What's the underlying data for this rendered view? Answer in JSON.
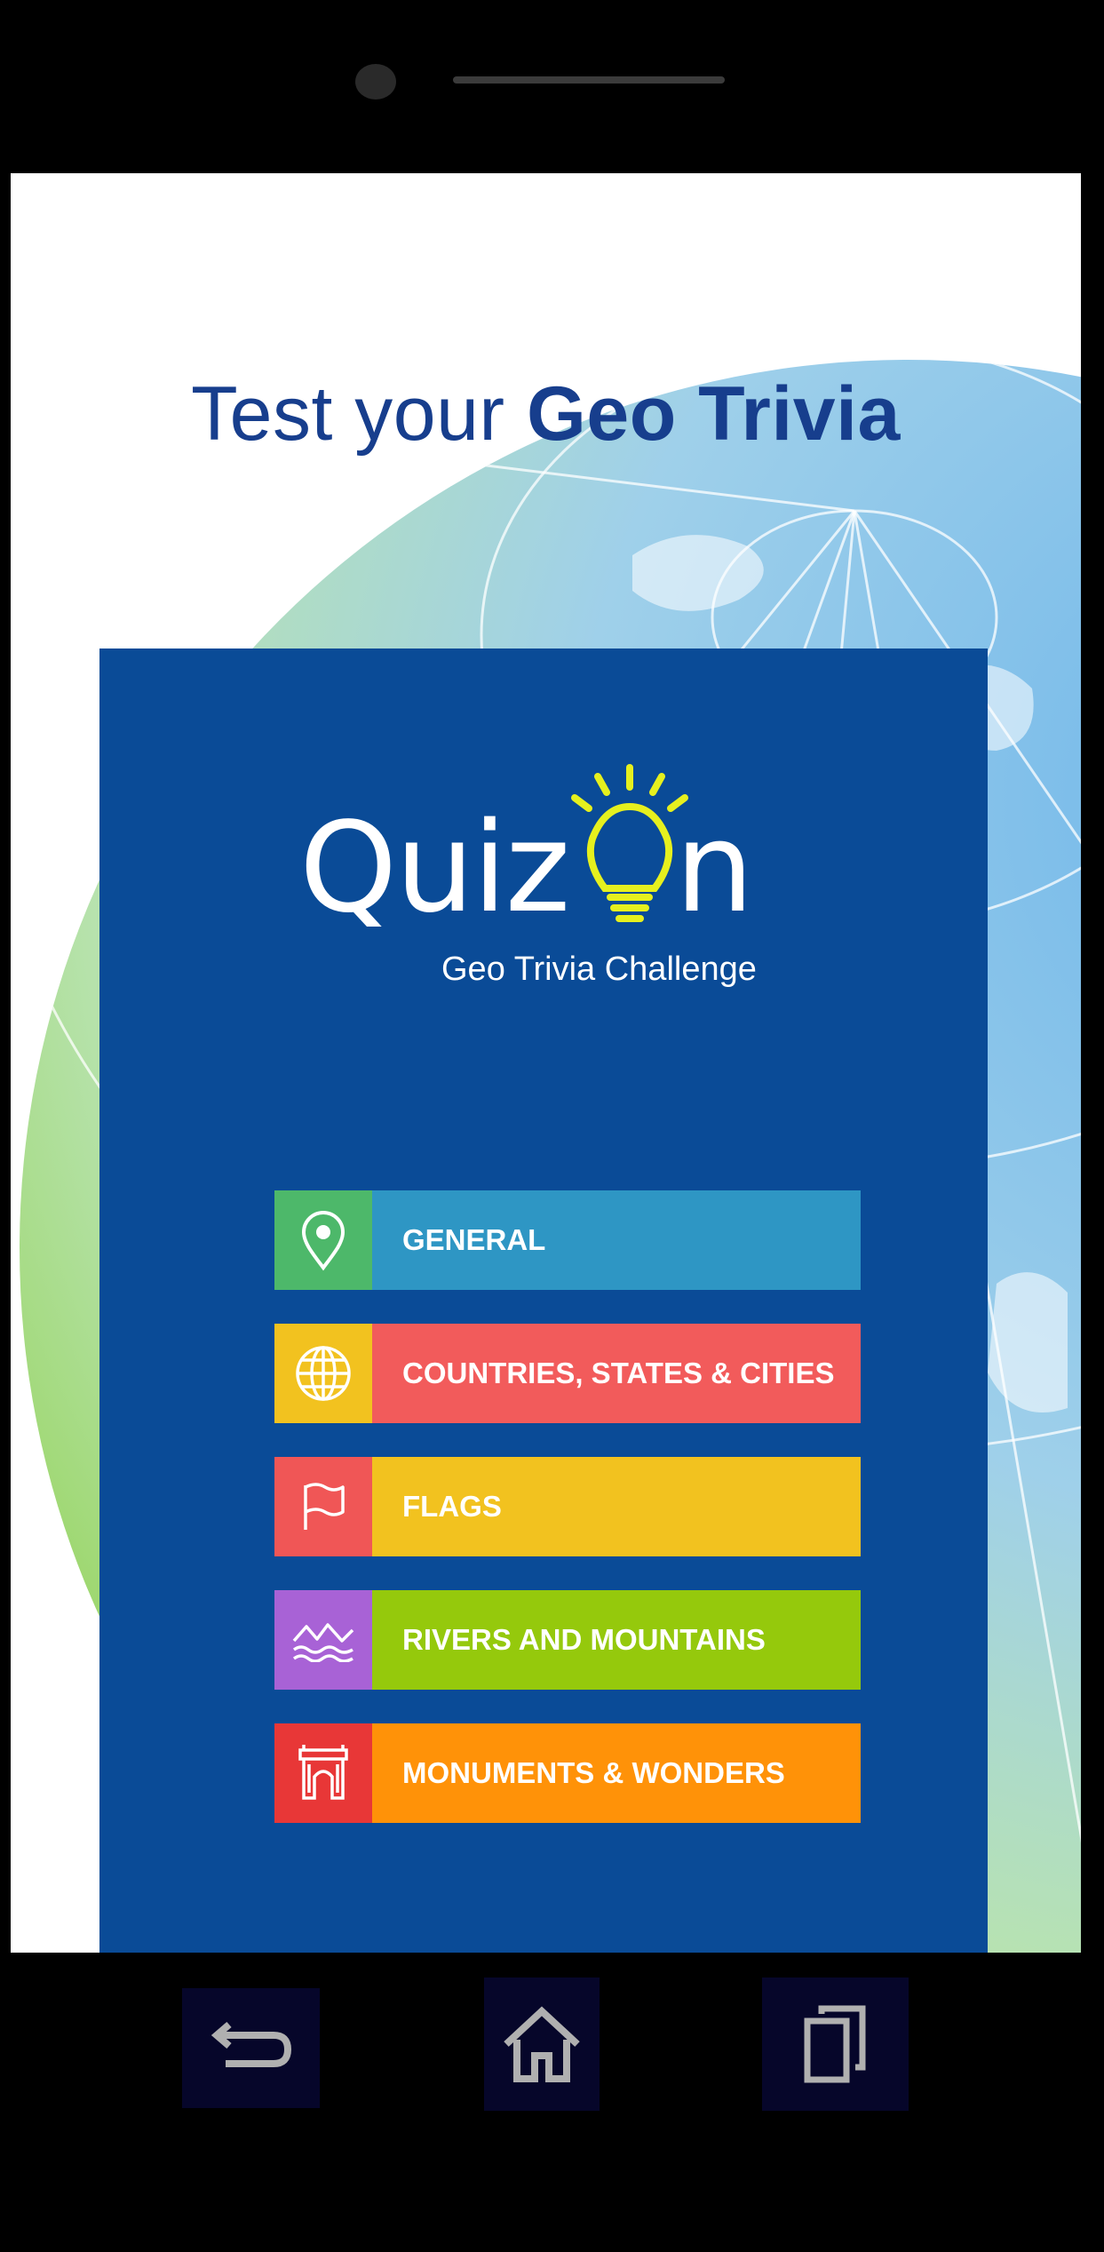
{
  "headline": {
    "light": "Test your ",
    "bold": "Geo Trivia"
  },
  "logo": {
    "word": "Quiz",
    "last_letter": "n",
    "subtitle": "Geo Trivia Challenge"
  },
  "categories": [
    {
      "label": "GENERAL",
      "icon": "map-pin-icon",
      "icon_color": "#4db86a",
      "color": "#2e96c4"
    },
    {
      "label": "COUNTRIES, STATES  & CITIES",
      "icon": "globe-icon",
      "icon_color": "#f2c21f",
      "color": "#f25b5b"
    },
    {
      "label": "FLAGS",
      "icon": "flag-icon",
      "icon_color": "#f05656",
      "color": "#f2c21f"
    },
    {
      "label": "RIVERS AND MOUNTAINS",
      "icon": "mountain-river-icon",
      "icon_color": "#a862d6",
      "color": "#95c90c"
    },
    {
      "label": "MONUMENTS & WONDERS",
      "icon": "arch-monument-icon",
      "icon_color": "#e83737",
      "color": "#ff9208"
    }
  ],
  "navbar": [
    {
      "icon": "back-icon"
    },
    {
      "icon": "home-icon"
    },
    {
      "icon": "recent-apps-icon"
    }
  ],
  "colors": {
    "panel": "#0a4b97",
    "headline": "#173e8d",
    "bulb": "#e6f01e"
  }
}
